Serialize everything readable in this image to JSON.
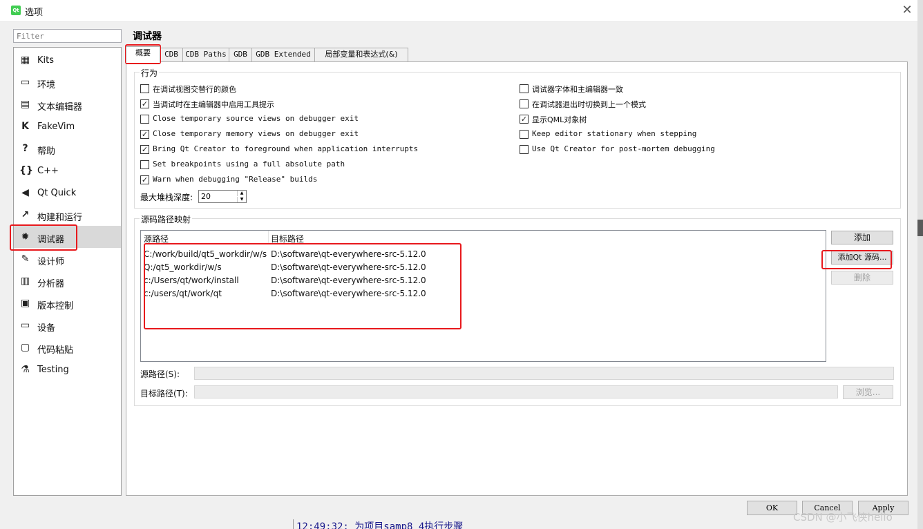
{
  "window": {
    "title": "选项",
    "app_icon": "qt-logo-icon",
    "close_glyph": "✕"
  },
  "sidebar": {
    "filter_placeholder": "Filter",
    "items": [
      {
        "label": "Kits",
        "icon": "kits-icon",
        "glyph": "▦"
      },
      {
        "label": "环境",
        "icon": "monitor-icon",
        "glyph": "▭"
      },
      {
        "label": "文本编辑器",
        "icon": "text-editor-icon",
        "glyph": "▤"
      },
      {
        "label": "FakeVim",
        "icon": "fakevim-icon",
        "glyph": "K"
      },
      {
        "label": "帮助",
        "icon": "help-icon",
        "glyph": "?"
      },
      {
        "label": "C++",
        "icon": "cpp-braces-icon",
        "glyph": "{}"
      },
      {
        "label": "Qt Quick",
        "icon": "qtquick-icon",
        "glyph": "◀"
      },
      {
        "label": "构建和运行",
        "icon": "hammer-icon",
        "glyph": "↗"
      },
      {
        "label": "调试器",
        "icon": "bug-icon",
        "glyph": "✹"
      },
      {
        "label": "设计师",
        "icon": "pencil-icon",
        "glyph": "✎"
      },
      {
        "label": "分析器",
        "icon": "analyzer-icon",
        "glyph": "▥"
      },
      {
        "label": "版本控制",
        "icon": "version-control-icon",
        "glyph": "▣"
      },
      {
        "label": "设备",
        "icon": "device-icon",
        "glyph": "▭"
      },
      {
        "label": "代码粘贴",
        "icon": "clipboard-icon",
        "glyph": "▢"
      },
      {
        "label": "Testing",
        "icon": "testing-flask-icon",
        "glyph": "⚗"
      }
    ],
    "active_index": 8
  },
  "main": {
    "title": "调试器",
    "tabs": [
      "概要",
      "CDB",
      "CDB Paths",
      "GDB",
      "GDB Extended",
      "局部变量和表达式(&)"
    ],
    "active_tab": 0,
    "behavior": {
      "title": "行为",
      "left_options": [
        {
          "label": "在调试视图交替行的颜色",
          "checked": false
        },
        {
          "label": "当调试时在主编辑器中启用工具提示",
          "checked": true
        },
        {
          "label": "Close temporary source views on debugger exit",
          "checked": false
        },
        {
          "label": "Close temporary memory views on debugger exit",
          "checked": true
        },
        {
          "label": "Bring Qt Creator to foreground when application interrupts",
          "checked": true
        },
        {
          "label": "Set breakpoints using a full absolute path",
          "checked": false
        },
        {
          "label": "Warn when debugging \"Release\" builds",
          "checked": true
        }
      ],
      "right_options": [
        {
          "label": "调试器字体和主编辑器一致",
          "checked": false
        },
        {
          "label": "在调试器退出时切换到上一个模式",
          "checked": false
        },
        {
          "label": "显示QML对象树",
          "checked": true
        },
        {
          "label": "Keep editor stationary when stepping",
          "checked": false
        },
        {
          "label": "Use Qt Creator for post-mortem debugging",
          "checked": false
        }
      ],
      "stack_depth_label": "最大堆栈深度:",
      "stack_depth_value": "20"
    },
    "source_paths": {
      "title": "源码路径映射",
      "columns": [
        "源路径",
        "目标路径"
      ],
      "rows": [
        {
          "source": "C:/work/build/qt5_workdir/w/s",
          "target": "D:\\software\\qt-everywhere-src-5.12.0"
        },
        {
          "source": "Q:/qt5_workdir/w/s",
          "target": "D:\\software\\qt-everywhere-src-5.12.0"
        },
        {
          "source": "c:/Users/qt/work/install",
          "target": "D:\\software\\qt-everywhere-src-5.12.0"
        },
        {
          "source": "c:/users/qt/work/qt",
          "target": "D:\\software\\qt-everywhere-src-5.12.0"
        }
      ],
      "add_button": "添加",
      "add_qt_button": "添加Qt 源码...",
      "delete_button": "删除",
      "source_path_label": "源路径(S):",
      "target_path_label": "目标路径(T):",
      "browse_button": "浏览..."
    }
  },
  "footer": {
    "ok": "OK",
    "cancel": "Cancel",
    "apply": "Apply"
  },
  "background": {
    "log_line": "12:49:32: 为项目samp8_4执行步骤",
    "watermark": "CSDN @小飞侠hello"
  },
  "colors": {
    "highlight_red": "#e8181c",
    "active_nav_bg": "#d9d9d9"
  }
}
